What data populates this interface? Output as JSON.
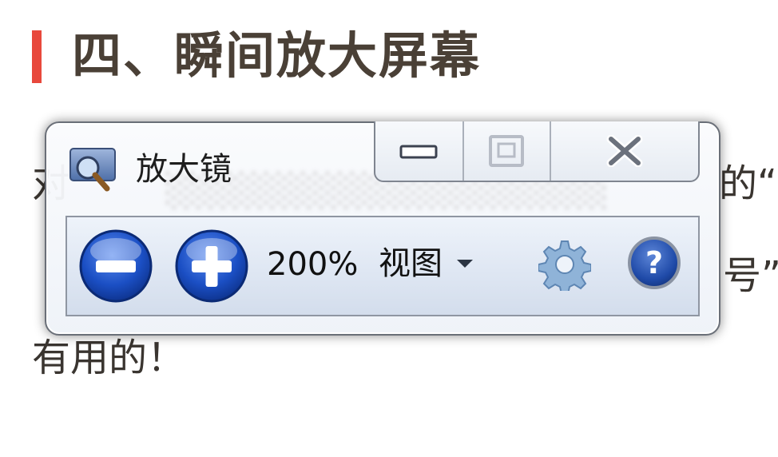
{
  "article": {
    "heading": "四、瞬间放大屏幕",
    "line1_start": "对",
    "line1_end": "的“",
    "line2_end": "号”",
    "line3": "有用的！"
  },
  "magnifier": {
    "title": "放大镜",
    "zoom_level": "200%",
    "views_label": "视图",
    "icons": {
      "app": "magnifier-icon",
      "minimize": "minimize-icon",
      "maximize": "maximize-icon",
      "close": "close-icon",
      "zoom_out": "zoom-out-icon",
      "zoom_in": "zoom-in-icon",
      "options": "gear-icon",
      "help": "help-icon",
      "dropdown": "caret-down-icon"
    }
  },
  "colors": {
    "accent": "#e8483c",
    "heading": "#4a4036",
    "round_button": "#1b4fc4",
    "help_button": "#1f4aa8"
  }
}
